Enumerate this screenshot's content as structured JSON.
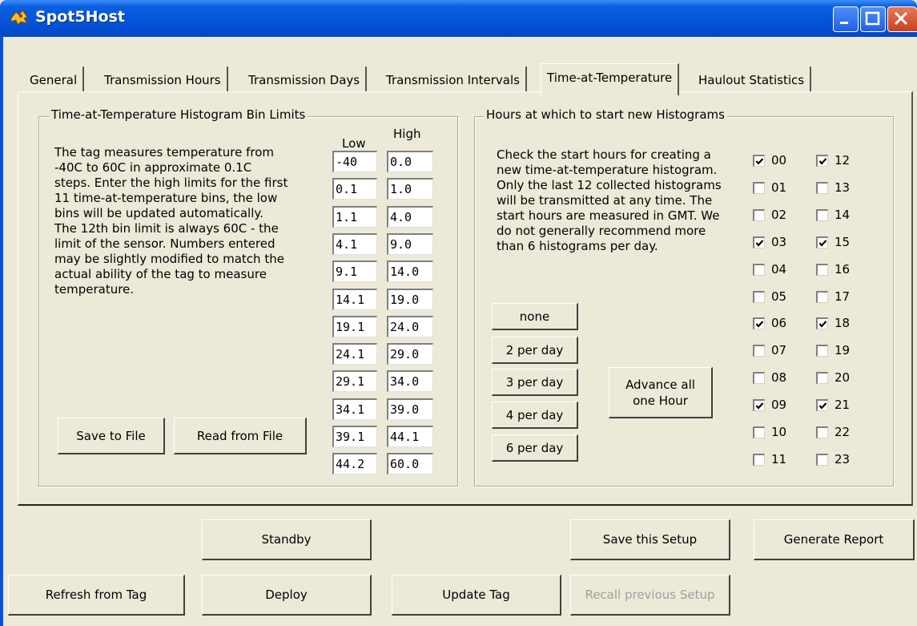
{
  "window": {
    "title": "Spot5Host"
  },
  "tabs": [
    {
      "label": "General"
    },
    {
      "label": "Transmission Hours"
    },
    {
      "label": "Transmission Days"
    },
    {
      "label": "Transmission Intervals"
    },
    {
      "label": "Time-at-Temperature"
    },
    {
      "label": "Haulout Statistics"
    }
  ],
  "bins_group": {
    "title": "Time-at-Temperature Histogram Bin Limits",
    "low_header": "Low",
    "high_header": "High",
    "description": [
      "The tag measures temperature from",
      "-40C to 60C in approximate 0.1C",
      "steps. Enter the high limits for the first",
      "11 time-at-temperature bins, the low",
      "bins will be updated automatically.",
      "The 12th bin limit is always 60C - the",
      "limit of the sensor.  Numbers entered",
      "may be slightly modified to match the",
      "actual ability of the tag to measure",
      "temperature."
    ],
    "rows": [
      {
        "low": "-40",
        "high": "0.0"
      },
      {
        "low": "0.1",
        "high": "1.0"
      },
      {
        "low": "1.1",
        "high": "4.0"
      },
      {
        "low": "4.1",
        "high": "9.0"
      },
      {
        "low": "9.1",
        "high": "14.0"
      },
      {
        "low": "14.1",
        "high": "19.0"
      },
      {
        "low": "19.1",
        "high": "24.0"
      },
      {
        "low": "24.1",
        "high": "29.0"
      },
      {
        "low": "29.1",
        "high": "34.0"
      },
      {
        "low": "34.1",
        "high": "39.0"
      },
      {
        "low": "39.1",
        "high": "44.1"
      },
      {
        "low": "44.2",
        "high": "60.0"
      }
    ],
    "save_button": "Save to File",
    "read_button": "Read from File"
  },
  "hours_group": {
    "title": "Hours at which to start new Histograms",
    "description": [
      "Check the start hours for creating a",
      "new time-at-temperature histogram.",
      "Only the last 12 collected histograms",
      "will be transmitted at any time.  The",
      "start hours are measured in GMT.  We",
      "do not generally recommend more",
      "than 6 histograms per day."
    ],
    "preset_buttons": [
      "none",
      "2 per day",
      "3 per day",
      "4 per day",
      "6 per day"
    ],
    "advance_button": [
      "Advance all",
      "one Hour"
    ],
    "hours": [
      {
        "label": "00",
        "checked": true
      },
      {
        "label": "01",
        "checked": false
      },
      {
        "label": "02",
        "checked": false
      },
      {
        "label": "03",
        "checked": true
      },
      {
        "label": "04",
        "checked": false
      },
      {
        "label": "05",
        "checked": false
      },
      {
        "label": "06",
        "checked": true
      },
      {
        "label": "07",
        "checked": false
      },
      {
        "label": "08",
        "checked": false
      },
      {
        "label": "09",
        "checked": true
      },
      {
        "label": "10",
        "checked": false
      },
      {
        "label": "11",
        "checked": false
      },
      {
        "label": "12",
        "checked": true
      },
      {
        "label": "13",
        "checked": false
      },
      {
        "label": "14",
        "checked": false
      },
      {
        "label": "15",
        "checked": true
      },
      {
        "label": "16",
        "checked": false
      },
      {
        "label": "17",
        "checked": false
      },
      {
        "label": "18",
        "checked": true
      },
      {
        "label": "19",
        "checked": false
      },
      {
        "label": "20",
        "checked": false
      },
      {
        "label": "21",
        "checked": true
      },
      {
        "label": "22",
        "checked": false
      },
      {
        "label": "23",
        "checked": false
      }
    ]
  },
  "bottom_buttons": {
    "standby": "Standby",
    "save_setup": "Save this Setup",
    "generate_report": "Generate Report",
    "refresh": "Refresh from Tag",
    "deploy": "Deploy",
    "update": "Update Tag",
    "recall": "Recall previous Setup"
  }
}
